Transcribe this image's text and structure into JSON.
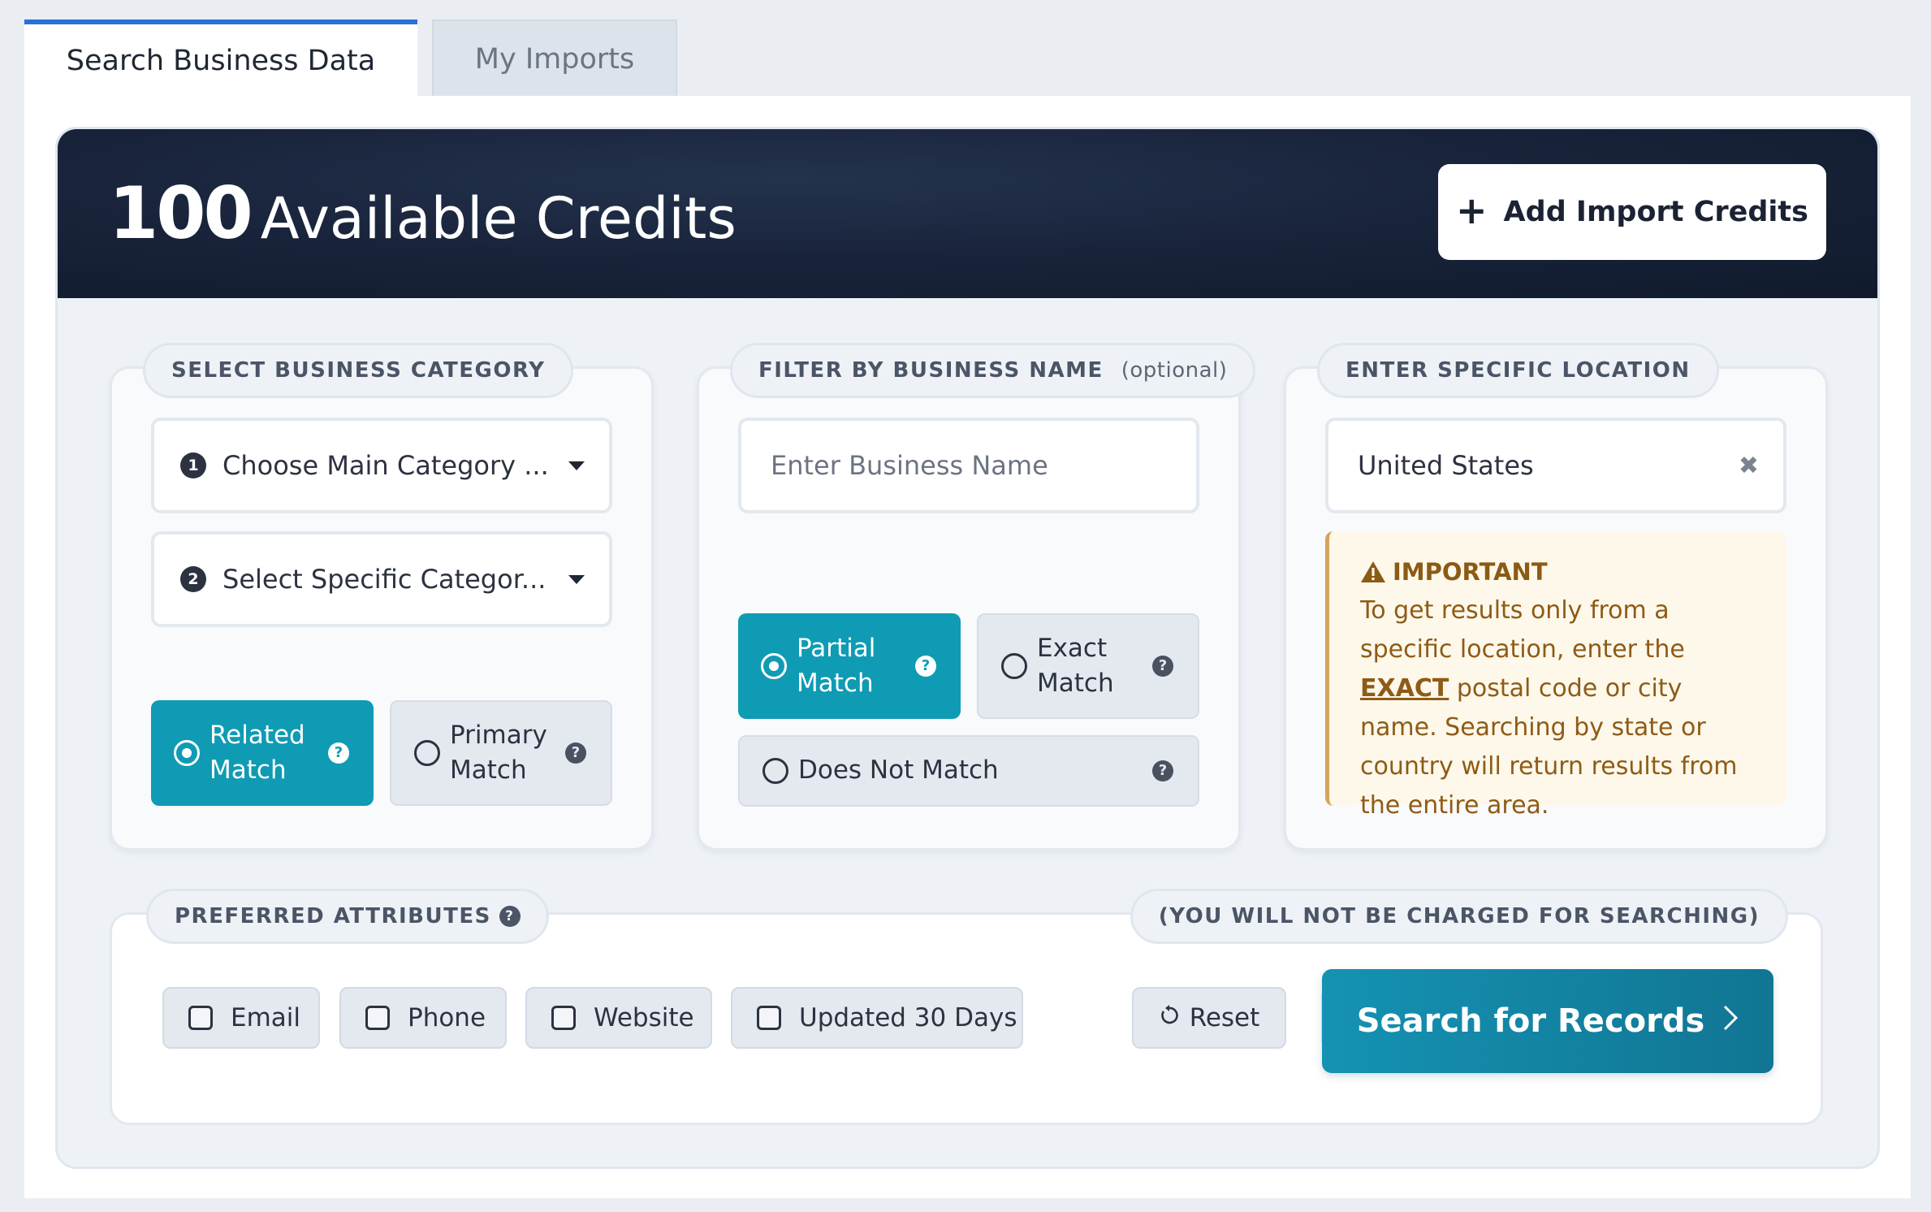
{
  "tabs": {
    "search_label": "Search Business Data",
    "imports_label": "My Imports"
  },
  "banner": {
    "credits_count": "100",
    "credits_label": "Available Credits",
    "add_credits_label": "Add Import Credits"
  },
  "category": {
    "title": "SELECT BUSINESS CATEGORY",
    "main_badge": "1",
    "main_placeholder": "Choose Main Category ...",
    "specific_badge": "2",
    "specific_placeholder": "Select Specific Categor...",
    "related_label": "Related Match",
    "primary_label": "Primary Match",
    "selected": "Related Match"
  },
  "name_filter": {
    "title": "FILTER BY BUSINESS NAME",
    "optional": "(optional)",
    "placeholder": "Enter Business Name",
    "value": "",
    "partial_label": "Partial Match",
    "exact_label": "Exact Match",
    "not_match_label": "Does Not Match",
    "selected": "Partial Match"
  },
  "location": {
    "title": "ENTER SPECIFIC LOCATION",
    "value": "United States",
    "clear_symbol": "✖",
    "notice_title": "IMPORTANT",
    "notice_part1": "To get results only from a specific location, enter the ",
    "notice_exact": "EXACT",
    "notice_part2": " postal code or city name. Searching by state or country will return results from the entire area."
  },
  "attributes": {
    "title": "PREFERRED ATTRIBUTES",
    "charge_note": "(YOU WILL NOT BE CHARGED FOR SEARCHING)",
    "email": "Email",
    "phone": "Phone",
    "website": "Website",
    "updated": "Updated 30 Days",
    "reset": "Reset",
    "search": "Search for Records"
  },
  "icons": {
    "help": "question-circle-icon",
    "warning": "warning-triangle-icon",
    "reset": "refresh-icon",
    "plus": "plus-icon",
    "chevron": "chevron-right-icon"
  },
  "colors": {
    "accent": "#0f9bb4",
    "banner": "#141e33",
    "tab_active_border": "#2a6fd6",
    "notice_text": "#8e5b17"
  }
}
